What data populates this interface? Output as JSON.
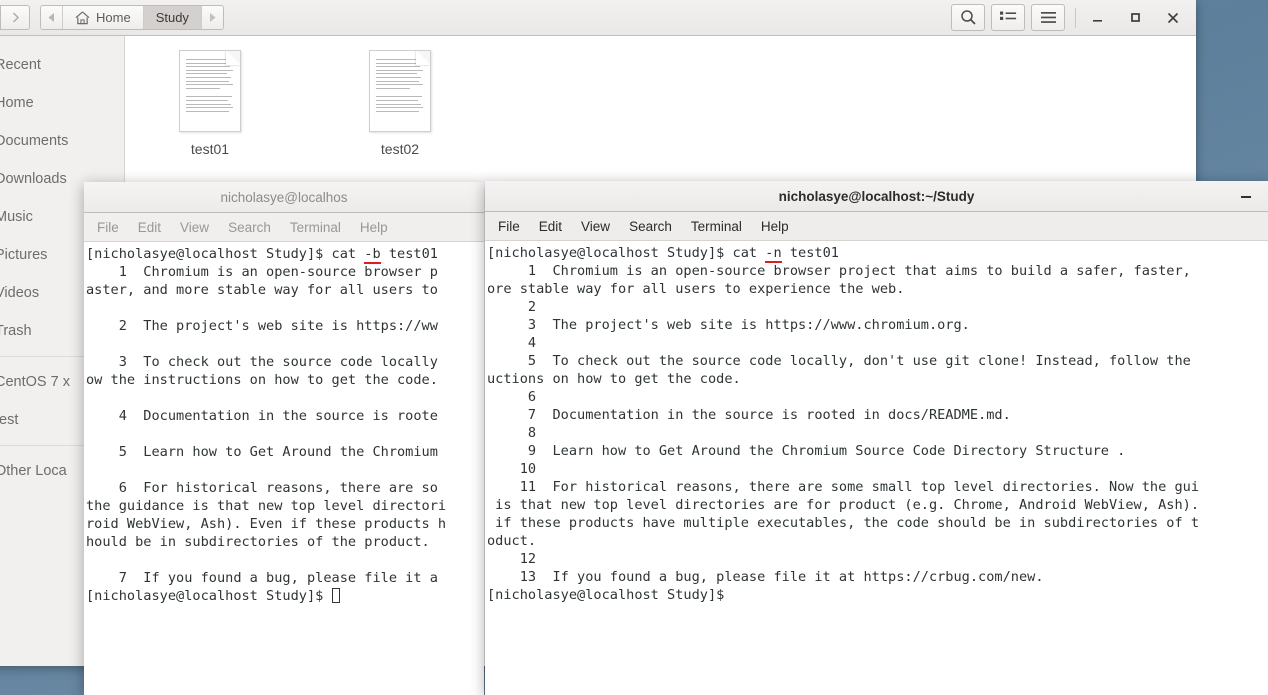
{
  "file_manager": {
    "nav": {
      "back_icon": "chevron-left-icon",
      "forward_icon": "chevron-right-icon"
    },
    "breadcrumb": {
      "prev_icon": "triangle-left-icon",
      "next_icon": "triangle-right-icon",
      "items": [
        {
          "label": "Home",
          "icon": "home-icon",
          "active": false
        },
        {
          "label": "Study",
          "icon": "",
          "active": true
        }
      ]
    },
    "toolbar": {
      "search_label": "search-icon",
      "view_list_label": "list-view-icon",
      "menu_label": "hamburger-menu-icon",
      "minimize_label": "–",
      "maximize_label": "□",
      "close_label": "✕"
    },
    "sidebar": {
      "items": [
        {
          "label": "Recent",
          "icon": "clock-icon"
        },
        {
          "label": "Home",
          "icon": "home-icon"
        },
        {
          "label": "Documents",
          "icon": "documents-icon"
        },
        {
          "label": "Downloads",
          "icon": "download-icon"
        },
        {
          "label": "Music",
          "icon": "music-icon"
        },
        {
          "label": "Pictures",
          "icon": "pictures-icon"
        },
        {
          "label": "Videos",
          "icon": "videos-icon"
        },
        {
          "label": "Trash",
          "icon": "trash-icon"
        }
      ],
      "devices": [
        {
          "label": "CentOS 7 x",
          "icon": "disc-icon"
        },
        {
          "label": "test",
          "icon": "drive-icon"
        }
      ],
      "other": {
        "label": "Other Loca",
        "icon": "plus-icon"
      }
    },
    "files": [
      {
        "name": "test01",
        "icon": "text-document-icon"
      },
      {
        "name": "test02",
        "icon": "text-document-icon"
      }
    ]
  },
  "terminal_left": {
    "title": "nicholasye@localhos",
    "active": false,
    "menu": [
      "File",
      "Edit",
      "View",
      "Search",
      "Terminal",
      "Help"
    ],
    "prompt": "[nicholasye@localhost Study]$ ",
    "command_prefix": "cat ",
    "command_flag": "-b",
    "command_suffix": " test01",
    "output": "    1  Chromium is an open-source browser p\naster, and more stable way for all users to \n\n    2  The project's web site is https://ww\n\n    3  To check out the source code locally\now the instructions on how to get the code. \n\n    4  Documentation in the source is roote\n\n    5  Learn how to Get Around the Chromium \n\n    6  For historical reasons, there are so\nthe guidance is that new top level directori\nroid WebView, Ash). Even if these products h\nhould be in subdirectories of the product.  \n\n    7  If you found a bug, please file it a",
    "final_prompt": "[nicholasye@localhost Study]$ ",
    "cursor": true
  },
  "terminal_right": {
    "title": "nicholasye@localhost:~/Study",
    "active": true,
    "minimize_label": "–",
    "menu": [
      "File",
      "Edit",
      "View",
      "Search",
      "Terminal",
      "Help"
    ],
    "prompt": "[nicholasye@localhost Study]$ ",
    "command_prefix": "cat ",
    "command_flag": "-n",
    "command_suffix": " test01",
    "output": "     1  Chromium is an open-source browser project that aims to build a safer, faster,\nore stable way for all users to experience the web.\n     2\n     3  The project's web site is https://www.chromium.org.\n     4\n     5  To check out the source code locally, don't use git clone! Instead, follow the\nuctions on how to get the code.\n     6\n     7  Documentation in the source is rooted in docs/README.md.\n     8\n     9  Learn how to Get Around the Chromium Source Code Directory Structure .\n    10\n    11  For historical reasons, there are some small top level directories. Now the gui\n is that new top level directories are for product (e.g. Chrome, Android WebView, Ash).\n if these products have multiple executables, the code should be in subdirectories of t\noduct.\n    12\n    13  If you found a bug, please file it at https://crbug.com/new.",
    "final_prompt": "[nicholasye@localhost Study]$ ",
    "cursor": false
  }
}
